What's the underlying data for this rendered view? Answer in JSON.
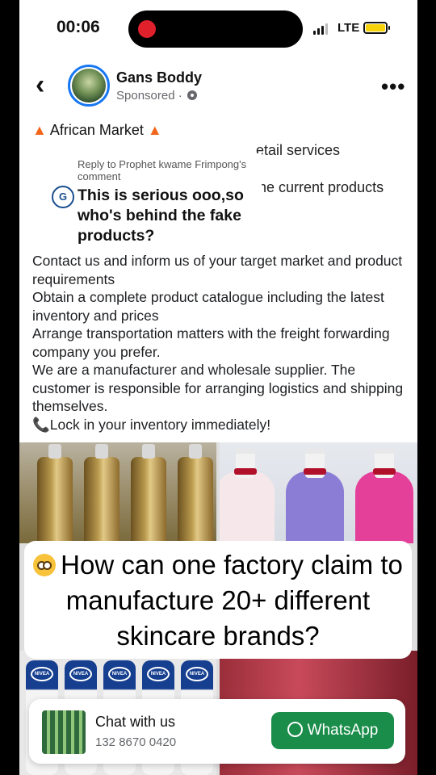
{
  "status_bar": {
    "time": "00:06",
    "network": "LTE"
  },
  "header": {
    "author": "Gans Boddy",
    "sponsored": "Sponsored ·"
  },
  "post": {
    "title": "African Market",
    "partial_line_1": "etail services",
    "partial_line_2": "the current products",
    "paragraphs": [
      "Contact us and inform us of your target market and product requirements",
      "Obtain a complete product catalogue including the latest inventory and prices",
      "Arrange transportation matters with the freight forwarding company you prefer.",
      "We are a manufacturer and wholesale supplier. The customer is responsible for arranging logistics and shipping themselves.",
      "📞Lock in your inventory immediately!"
    ]
  },
  "reply": {
    "reply_to": "Reply to Prophet kwame Frimpong's comment",
    "avatar_initials": "G",
    "text": "This is serious ooo,so who's behind the fake products?"
  },
  "overlay": {
    "question": "How can one factory claim to manufacture 20+ different skincare brands?"
  },
  "chat": {
    "label": "Chat with us",
    "phone": "132 8670 0420",
    "button": "WhatsApp"
  },
  "colors": {
    "accent_blue": "#1877f2",
    "whatsapp_green": "#1a8d4a",
    "recording_red": "#e0202b"
  }
}
